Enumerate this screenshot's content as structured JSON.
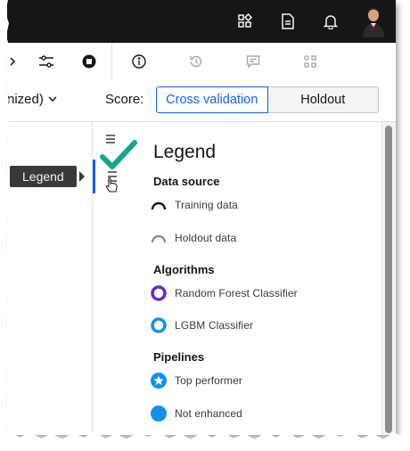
{
  "toolbar": {
    "icons": [
      "chevron-right-icon",
      "settings-adjust-icon",
      "stop-icon",
      "info-icon",
      "history-icon",
      "comment-icon",
      "apps-icon"
    ]
  },
  "controls": {
    "dropdown_text": "nized)",
    "score_label": "Score:",
    "cross_validation": "Cross validation",
    "holdout": "Holdout"
  },
  "tooltip": "Legend",
  "legend": {
    "title": "Legend",
    "data_source_heading": "Data source",
    "training_data": "Training data",
    "holdout_data": "Holdout data",
    "algorithms_heading": "Algorithms",
    "rf": "Random Forest Classifier",
    "lgbm": "LGBM Classifier",
    "pipelines_heading": "Pipelines",
    "top_performer": "Top performer",
    "not_enhanced": "Not enhanced"
  },
  "colors": {
    "accent": "#0f62fe",
    "rf_purple": "#6929c4",
    "lgbm_blue": "#1192e8",
    "check_green": "#12a88a",
    "topbar": "#161616"
  }
}
